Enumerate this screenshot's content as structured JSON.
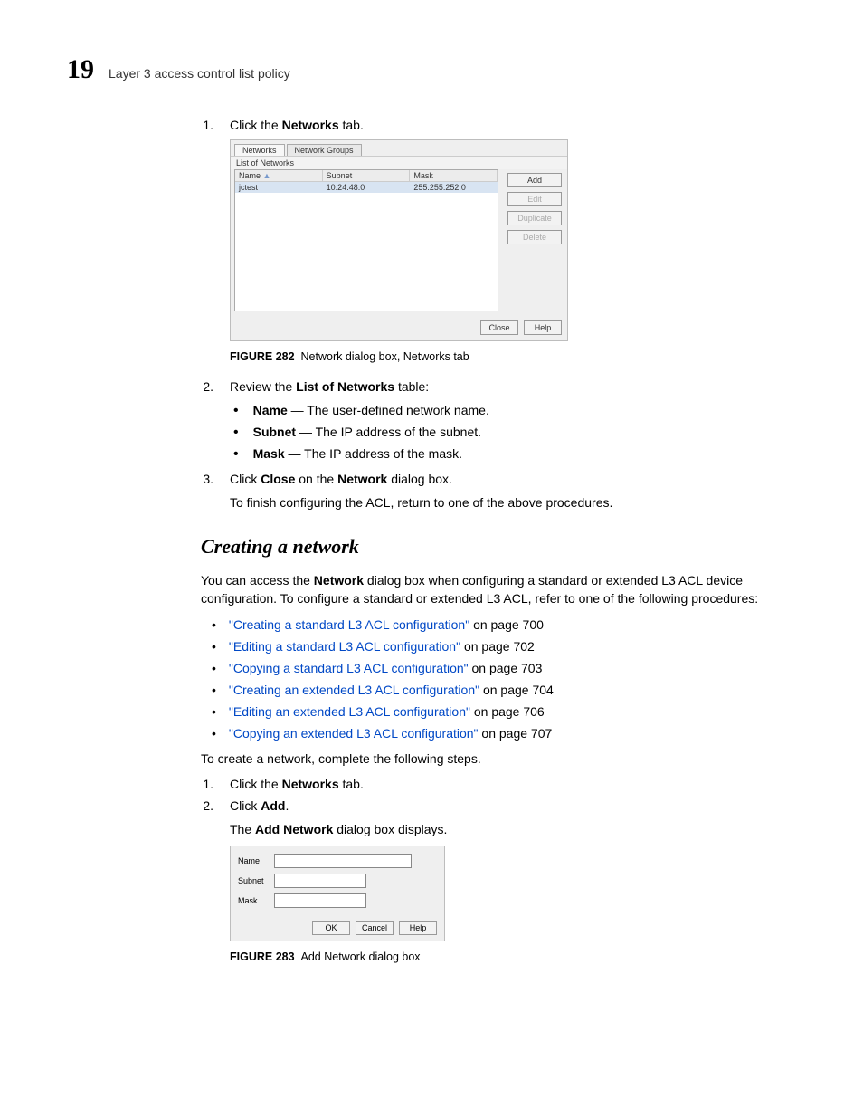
{
  "header": {
    "page_number": "19",
    "title": "Layer 3 access control list policy"
  },
  "steps_top": [
    {
      "num": "1.",
      "pre": "Click the",
      "bold": "Networks",
      "post": "tab."
    },
    {
      "num": "2.",
      "pre": "Review the",
      "bold": "List of Networks",
      "post": "table:"
    },
    {
      "num": "3.",
      "pre": "Click",
      "bold1": "Close",
      "mid": "on the",
      "bold2": "Network",
      "post": "dialog box.",
      "followup": "To finish configuring the ACL, return to one of the above procedures."
    }
  ],
  "definitions": [
    {
      "term": "Name",
      "desc": "— The user-defined network name."
    },
    {
      "term": "Subnet",
      "desc": "— The IP address of the subnet."
    },
    {
      "term": "Mask",
      "desc": "— The IP address of the mask."
    }
  ],
  "figure1": {
    "tabs": [
      "Networks",
      "Network Groups"
    ],
    "subhead": "List of Networks",
    "columns": [
      "Name",
      "Subnet",
      "Mask"
    ],
    "row": [
      "jctest",
      "10.24.48.0",
      "255.255.252.0"
    ],
    "buttons": {
      "add": "Add",
      "edit": "Edit",
      "duplicate": "Duplicate",
      "delete": "Delete",
      "close": "Close",
      "help": "Help"
    },
    "caption_label": "FIGURE 282",
    "caption_text": "Network dialog box, Networks tab"
  },
  "section": {
    "heading": "Creating a network",
    "intro": {
      "pre": "You can access the",
      "bold": "Network",
      "post": "dialog box when configuring a standard or extended L3 ACL device configuration. To configure a standard or extended L3 ACL, refer to one of the following procedures:"
    },
    "links": [
      {
        "text": "\"Creating a standard L3 ACL configuration\"",
        "tail": "on page 700"
      },
      {
        "text": "\"Editing a standard L3 ACL configuration\"",
        "tail": "on page 702"
      },
      {
        "text": "\"Copying a standard L3 ACL configuration\"",
        "tail": "on page 703"
      },
      {
        "text": "\"Creating an extended L3 ACL configuration\"",
        "tail": "on page 704"
      },
      {
        "text": "\"Editing an extended L3 ACL configuration\"",
        "tail": "on page 706"
      },
      {
        "text": "\"Copying an extended L3 ACL configuration\"",
        "tail": "on page 707"
      }
    ],
    "lead": "To create a network, complete the following steps."
  },
  "steps_bottom": [
    {
      "num": "1.",
      "pre": "Click the",
      "bold": "Networks",
      "post": "tab."
    },
    {
      "num": "2.",
      "pre": "Click",
      "bold": "Add",
      "post": ".",
      "follow_pre": "The",
      "follow_bold": "Add Network",
      "follow_post": "dialog box displays."
    }
  ],
  "figure2": {
    "fields": [
      "Name",
      "Subnet",
      "Mask"
    ],
    "buttons": {
      "ok": "OK",
      "cancel": "Cancel",
      "help": "Help"
    },
    "caption_label": "FIGURE 283",
    "caption_text": "Add Network dialog box"
  }
}
